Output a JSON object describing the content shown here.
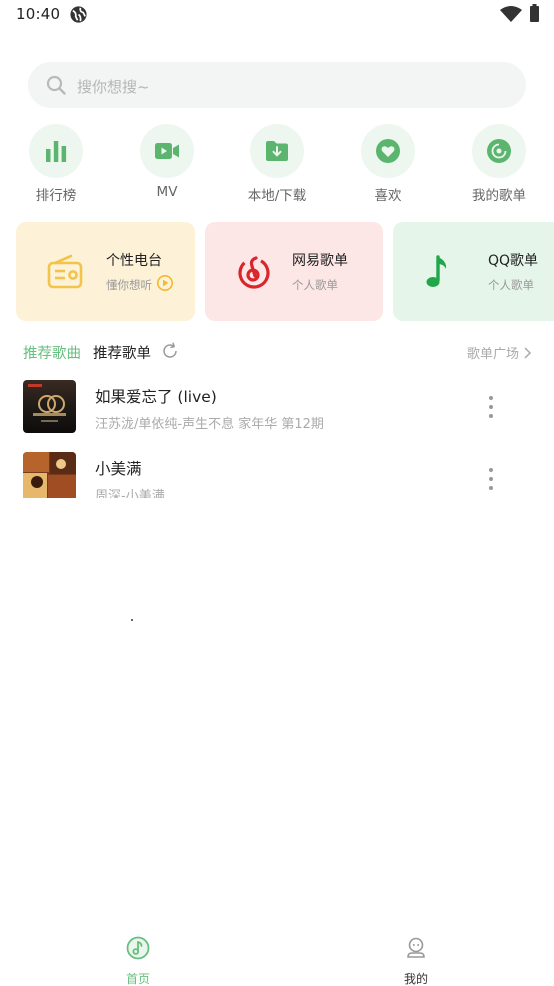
{
  "status_bar": {
    "time": "10:40"
  },
  "search": {
    "placeholder": "搜你想搜~"
  },
  "quick_actions": [
    {
      "label": "排行榜",
      "icon": "bar-chart-icon"
    },
    {
      "label": "MV",
      "icon": "video-icon"
    },
    {
      "label": "本地/下载",
      "icon": "download-folder-icon"
    },
    {
      "label": "喜欢",
      "icon": "heart-icon"
    },
    {
      "label": "我的歌单",
      "icon": "disc-icon"
    }
  ],
  "cards": [
    {
      "title": "个性电台",
      "subtitle": "懂你想听",
      "icon": "radio-icon",
      "bg": "#fdf2d8",
      "accent": "#f3c44a"
    },
    {
      "title": "网易歌单",
      "subtitle": "个人歌单",
      "icon": "netease-icon",
      "bg": "#fde6e6",
      "accent": "#d9262c"
    },
    {
      "title": "QQ歌单",
      "subtitle": "个人歌单",
      "icon": "qq-music-icon",
      "bg": "#e6f5e9",
      "accent": "#22a64a"
    }
  ],
  "section": {
    "tab_songs": "推荐歌曲",
    "tab_playlists": "推荐歌单",
    "square_link": "歌单广场"
  },
  "songs": [
    {
      "title": "如果爱忘了 (live)",
      "subtitle": "汪苏泷/单依纯-声生不息 家年华 第12期"
    },
    {
      "title": "小美满",
      "subtitle": "周深-小美满"
    }
  ],
  "bottom_nav": [
    {
      "label": "首页",
      "active": true
    },
    {
      "label": "我的",
      "active": false
    }
  ],
  "colors": {
    "accent_green": "#67bf7f",
    "icon_circle_bg": "#edf7ef",
    "search_bg": "#f3f4f4"
  }
}
